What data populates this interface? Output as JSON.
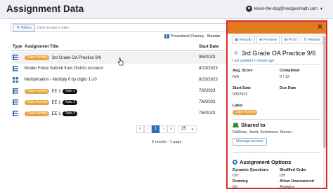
{
  "header": {
    "title": "Assignment Data",
    "user": "kevin-the-dog@nextgenmath.com"
  },
  "filter": {
    "button": "Filters",
    "placeholder": "Click to add a filter"
  },
  "tag": {
    "label": "Procedural Fluency",
    "label2": "Standar"
  },
  "table": {
    "columns": {
      "type": "Type",
      "title": "Assignment Title",
      "date": "Start Date"
    },
    "rows": [
      {
        "icon": "list-icon",
        "badge": "Class Activity",
        "title": "3rd Grade OA Practice 9/6",
        "take": "",
        "date": "9/6/2023"
      },
      {
        "icon": "list-icon",
        "badge": "",
        "title": "Kinder Force Submit from District Account",
        "take": "",
        "date": "8/23/2023"
      },
      {
        "icon": "grid-icon",
        "badge": "",
        "title": "Multiplication - Multiply 6 by digits 1-10",
        "take": "",
        "date": "8/22/2023"
      },
      {
        "icon": "list-icon",
        "badge": "Class Activity",
        "title": "EE 1",
        "take": "Take 1",
        "date": "7/6/2023"
      },
      {
        "icon": "list-icon",
        "badge": "Class Activity",
        "title": "EE 1",
        "take": "Take 2",
        "date": "7/6/2023"
      },
      {
        "icon": "list-icon",
        "badge": "Class Activity",
        "title": "EE 1",
        "take": "Take 3",
        "date": "7/6/2023"
      }
    ]
  },
  "pagination": {
    "first": "«",
    "prev": "‹",
    "current": "1",
    "next": "›",
    "last": "»",
    "page_size": "25",
    "summary": "6 results - 1 page"
  },
  "panel": {
    "tabs": [
      "Results",
      "Preview",
      "Print",
      "Retake"
    ],
    "title": "3rd Grade OA Practice 9/6",
    "updated": "Last updated 1 minute ago",
    "avg_score_label": "Avg. Score",
    "avg_score": "N/A",
    "completed_label": "Completed",
    "completed": "0 / 12",
    "start_date_label": "Start Date",
    "start_date": "9/5/2023",
    "due_date_label": "Due Date",
    "due_date": "",
    "label_label": "Label",
    "label_value": "Class Activity",
    "shared_title": "Shared to",
    "shared_names": "DeMoss, Joost, Schemers, Steven",
    "manage_access": "Manage access",
    "options_title": "Assignment Options",
    "dynamic_label": "Dynamic Questions",
    "dynamic_value": "Off",
    "shuffled_label": "Shuffled Order",
    "shuffled_value": "Off",
    "drawing_label": "Drawing",
    "drawing_value": "On",
    "unanswered_label": "Allow Unanswered",
    "unanswered_value": "Answers"
  },
  "colors": {
    "accent": "#2f6fc0",
    "badge": "#e9a23b",
    "panel_header": "#e07b1e",
    "panel_border": "#d92c2c"
  }
}
